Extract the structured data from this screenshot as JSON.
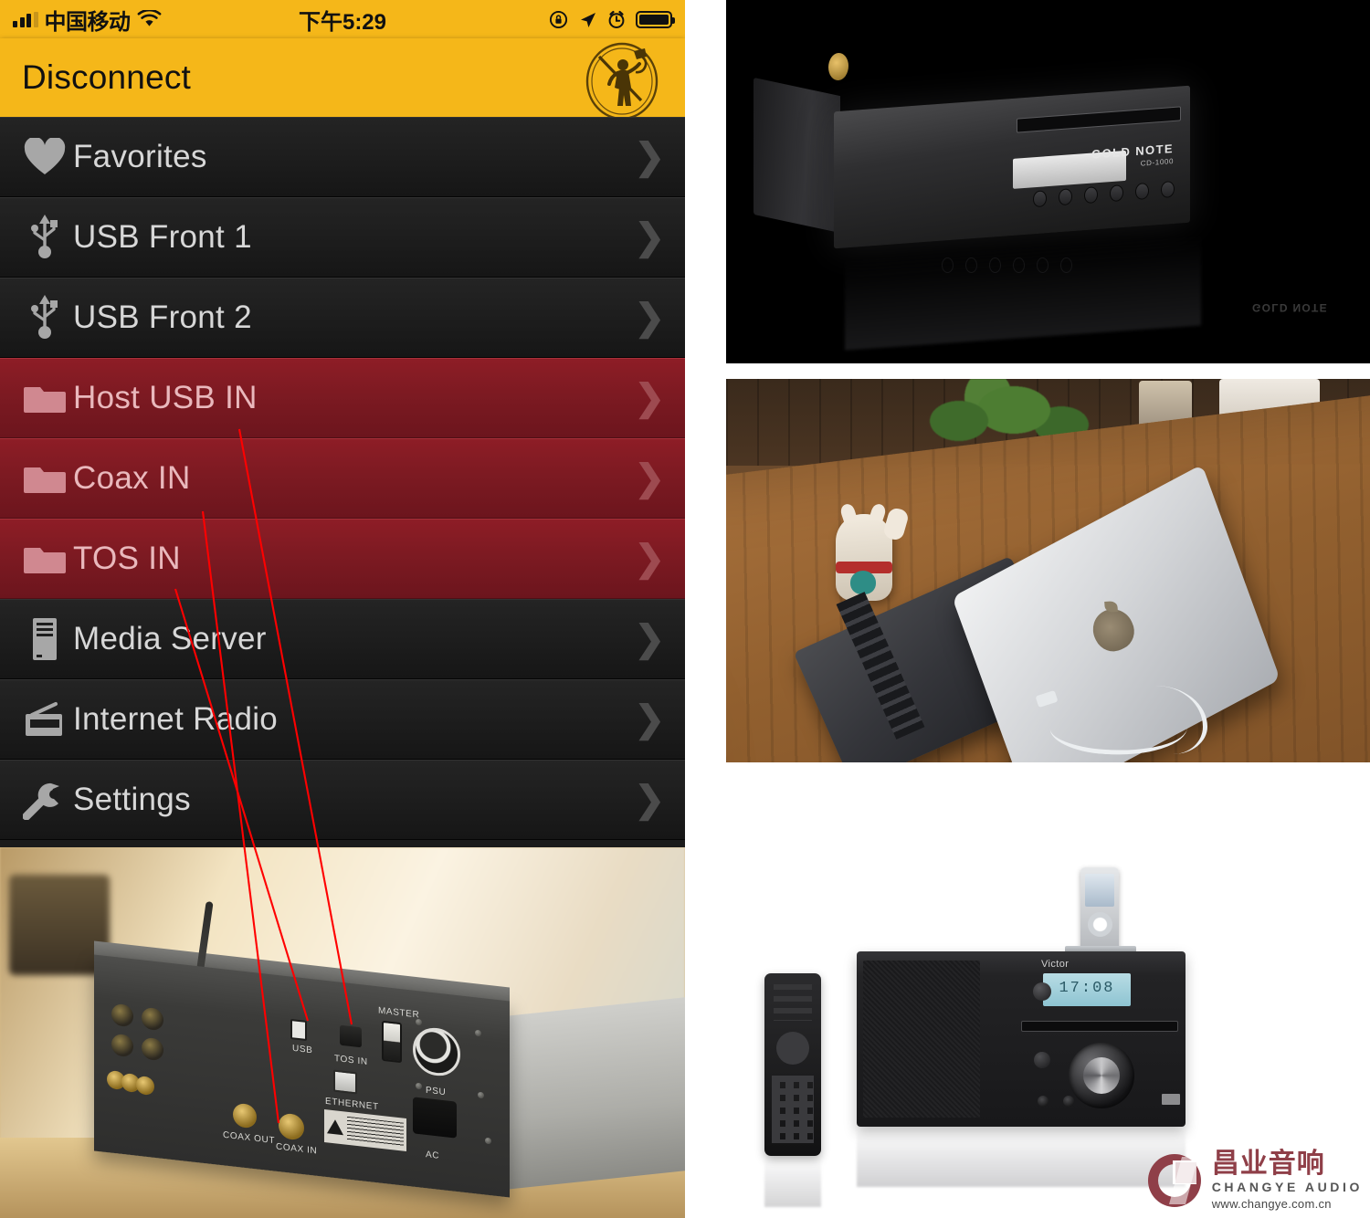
{
  "statusbar": {
    "carrier": "中国移动",
    "time": "下午5:29",
    "icons": [
      "signal-bars-icon",
      "wifi-icon",
      "rotation-lock-icon",
      "location-arrow-icon",
      "alarm-clock-icon",
      "battery-icon"
    ]
  },
  "navbar": {
    "title": "Disconnect",
    "logo_name": "gold-note-trumpeter-logo"
  },
  "menu": {
    "items": [
      {
        "label": "Favorites",
        "icon": "heart-icon",
        "active": false
      },
      {
        "label": "USB Front 1",
        "icon": "usb-icon",
        "active": false
      },
      {
        "label": "USB Front 2",
        "icon": "usb-icon",
        "active": false
      },
      {
        "label": "Host USB IN",
        "icon": "folder-icon",
        "active": true
      },
      {
        "label": "Coax IN",
        "icon": "folder-icon",
        "active": true
      },
      {
        "label": "TOS IN",
        "icon": "folder-icon",
        "active": true
      },
      {
        "label": "Media Server",
        "icon": "server-tower-icon",
        "active": false
      },
      {
        "label": "Internet Radio",
        "icon": "radio-icon",
        "active": false
      },
      {
        "label": "Settings",
        "icon": "wrench-icon",
        "active": false
      }
    ],
    "chevron": "❯"
  },
  "colors": {
    "accent_amber": "#f5b719",
    "highlight_red": "#8e1d26",
    "list_bg": "#1d1d1d",
    "label_gray": "#d7d7d7",
    "leader_line_red": "#ff0000"
  },
  "images": {
    "cd_player": {
      "name": "gold-note-cd-player-photo",
      "brand": "GOLD NOTE",
      "model": "CD-1000",
      "button_count": 6
    },
    "desk_setup": {
      "name": "macbook-usb-dac-desk-photo",
      "items": [
        "lucky-cat-figurine",
        "macbook-laptop",
        "portable-dac",
        "usb-cable",
        "plant",
        "wooden-desk"
      ]
    },
    "victor_system": {
      "name": "victor-micro-hifi-photo",
      "brand": "Victor",
      "display_value": "17:08",
      "items": [
        "ipod-dock",
        "remote-control",
        "cd-slot",
        "volume-knob",
        "lcd-display",
        "usb-port"
      ]
    },
    "rear_panel": {
      "name": "amplifier-rear-panel-photo",
      "labels": [
        "USB",
        "TOS IN",
        "ETHERNET",
        "MASTER",
        "PSU",
        "COAX IN",
        "COAX OUT",
        "AC"
      ],
      "annotation_note": "red leader lines link Host USB IN / Coax IN / TOS IN menu rows to the USB, COAX IN and TOS IN jacks"
    }
  },
  "watermark": {
    "cn": "昌业音响",
    "en": "CHANGYE AUDIO",
    "url": "www.changye.com.cn"
  }
}
